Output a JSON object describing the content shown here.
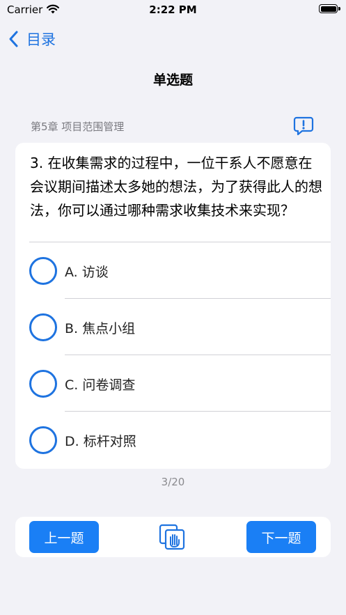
{
  "status_bar": {
    "carrier": "Carrier",
    "time": "2:22 PM"
  },
  "nav": {
    "back_label": "目录",
    "title": "单选题"
  },
  "chapter": "第5章 项目范围管理",
  "question": {
    "text": "3. 在收集需求的过程中，一位干系人不愿意在会议期间描述太多她的想法，为了获得此人的想法，你可以通过哪种需求收集技术来实现？",
    "options": [
      {
        "label": "A. 访谈"
      },
      {
        "label": "B. 焦点小组"
      },
      {
        "label": "C. 问卷调查"
      },
      {
        "label": "D. 标杆对照"
      }
    ]
  },
  "progress": "3/20",
  "bottom_bar": {
    "prev_label": "上一题",
    "next_label": "下一题"
  },
  "colors": {
    "accent": "#1e73e0",
    "button": "#1a7ff5",
    "background": "#f2f2f7"
  }
}
